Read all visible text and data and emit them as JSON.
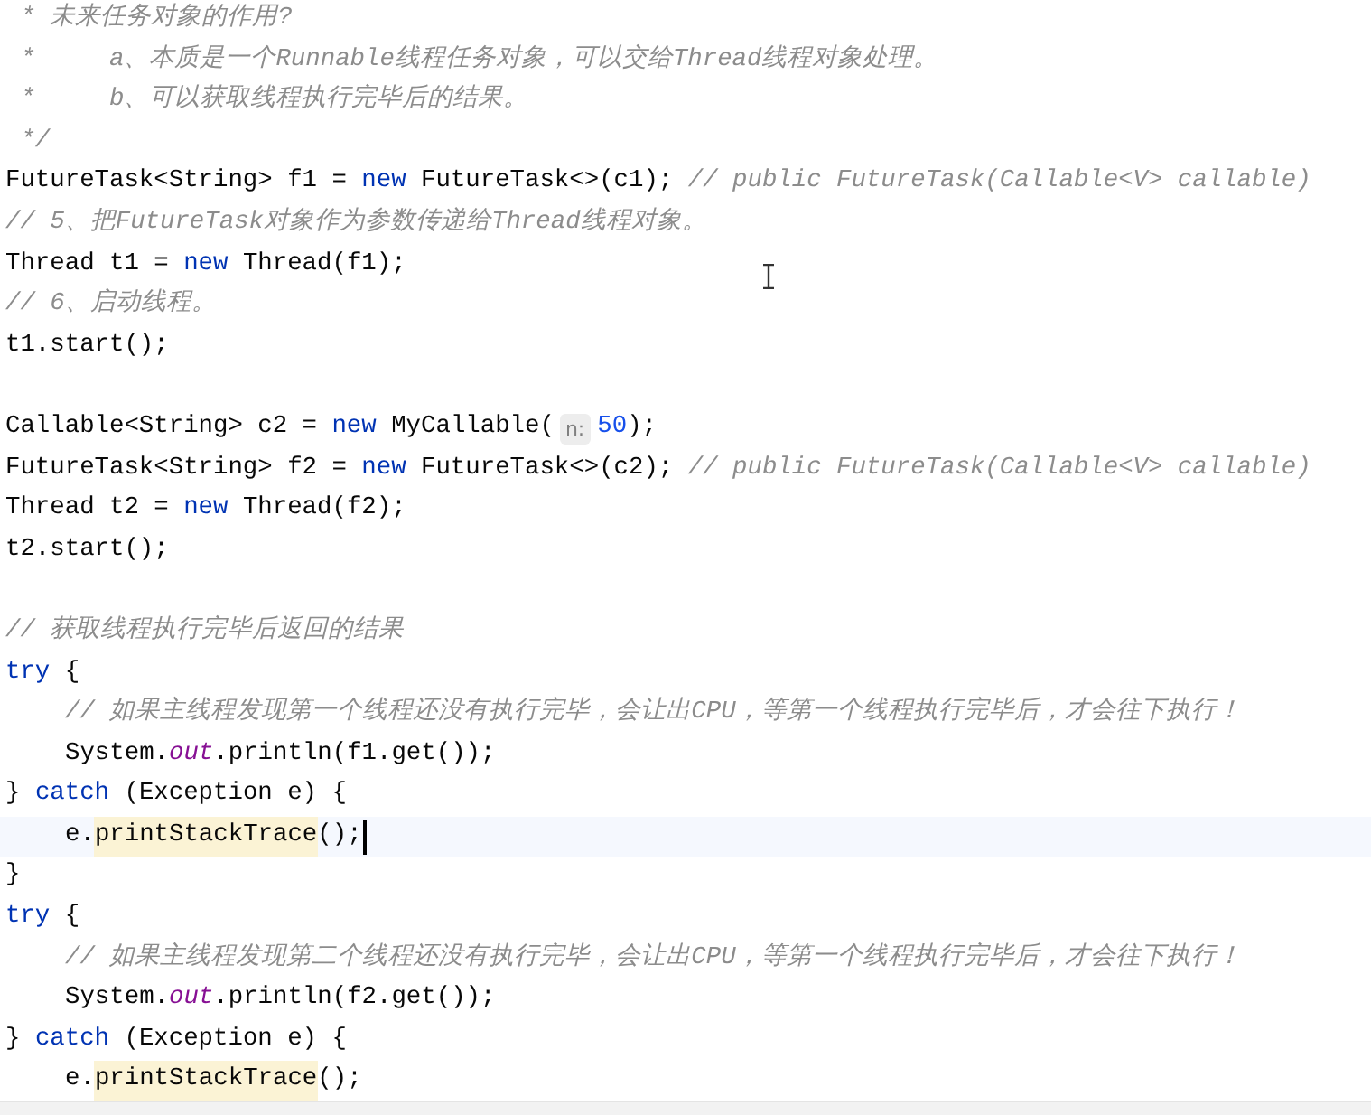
{
  "editor": {
    "lines": [
      {
        "tokens": [
          {
            "kind": "comment",
            "text": " * 未来任务对象的作用?"
          }
        ]
      },
      {
        "tokens": [
          {
            "kind": "comment",
            "text": " *     a、本质是一个Runnable线程任务对象，可以交给Thread线程对象处理。"
          }
        ]
      },
      {
        "tokens": [
          {
            "kind": "comment",
            "text": " *     b、可以获取线程执行完毕后的结果。"
          }
        ]
      },
      {
        "tokens": [
          {
            "kind": "comment",
            "text": " */"
          }
        ]
      },
      {
        "tokens": [
          {
            "kind": "text",
            "text": "FutureTask<String> f1 = "
          },
          {
            "kind": "keyword",
            "text": "new"
          },
          {
            "kind": "text",
            "text": " FutureTask<>(c1);"
          },
          {
            "kind": "comment",
            "text": " // public FutureTask(Callable<V> callable)"
          }
        ]
      },
      {
        "tokens": [
          {
            "kind": "comment",
            "text": "// 5、把FutureTask对象作为参数传递给Thread线程对象。"
          }
        ]
      },
      {
        "tokens": [
          {
            "kind": "text",
            "text": "Thread t1 = "
          },
          {
            "kind": "keyword",
            "text": "new"
          },
          {
            "kind": "text",
            "text": " Thread(f1);"
          }
        ]
      },
      {
        "tokens": [
          {
            "kind": "comment",
            "text": "// 6、启动线程。"
          }
        ]
      },
      {
        "tokens": [
          {
            "kind": "text",
            "text": "t1.start();"
          }
        ]
      },
      {
        "blank_before": true,
        "tokens": [
          {
            "kind": "text",
            "text": "Callable<String> c2 = "
          },
          {
            "kind": "keyword",
            "text": "new"
          },
          {
            "kind": "text",
            "text": " MyCallable("
          },
          {
            "kind": "hint",
            "text": "n:"
          },
          {
            "kind": "number",
            "text": "50"
          },
          {
            "kind": "text",
            "text": ");"
          }
        ]
      },
      {
        "tokens": [
          {
            "kind": "text",
            "text": "FutureTask<String> f2 = "
          },
          {
            "kind": "keyword",
            "text": "new"
          },
          {
            "kind": "text",
            "text": " FutureTask<>(c2);"
          },
          {
            "kind": "comment",
            "text": " // public FutureTask(Callable<V> callable)"
          }
        ]
      },
      {
        "tokens": [
          {
            "kind": "text",
            "text": "Thread t2 = "
          },
          {
            "kind": "keyword",
            "text": "new"
          },
          {
            "kind": "text",
            "text": " Thread(f2);"
          }
        ]
      },
      {
        "tokens": [
          {
            "kind": "text",
            "text": "t2.start();"
          }
        ]
      },
      {
        "blank_before": true,
        "tokens": [
          {
            "kind": "comment",
            "text": "// 获取线程执行完毕后返回的结果"
          }
        ]
      },
      {
        "tokens": [
          {
            "kind": "keyword",
            "text": "try"
          },
          {
            "kind": "text",
            "text": " {"
          }
        ],
        "children": [
          {
            "tokens": [
              {
                "kind": "comment",
                "text": "// 如果主线程发现第一个线程还没有执行完毕，会让出CPU，等第一个线程执行完毕后，才会往下执行！"
              }
            ]
          },
          {
            "tokens": [
              {
                "kind": "text",
                "text": "System."
              },
              {
                "kind": "field",
                "text": "out"
              },
              {
                "kind": "text",
                "text": ".println(f1.get());"
              }
            ]
          }
        ]
      },
      {
        "tokens": [
          {
            "kind": "text",
            "text": "} "
          },
          {
            "kind": "keyword",
            "text": "catch"
          },
          {
            "kind": "text",
            "text": " (Exception e) {"
          }
        ],
        "children": [
          {
            "current": true,
            "tokens": [
              {
                "kind": "text",
                "text": "e."
              },
              {
                "kind": "usage",
                "text": "printStackTrace"
              },
              {
                "kind": "text",
                "text": "();"
              }
            ]
          }
        ]
      },
      {
        "tokens": [
          {
            "kind": "text",
            "text": "}"
          }
        ]
      },
      {
        "tokens": [
          {
            "kind": "keyword",
            "text": "try"
          },
          {
            "kind": "text",
            "text": " {"
          }
        ],
        "children": [
          {
            "tokens": [
              {
                "kind": "comment",
                "text": "// 如果主线程发现第二个线程还没有执行完毕，会让出CPU，等第一个线程执行完毕后，才会往下执行！"
              }
            ]
          },
          {
            "tokens": [
              {
                "kind": "text",
                "text": "System."
              },
              {
                "kind": "field",
                "text": "out"
              },
              {
                "kind": "text",
                "text": ".println(f2.get());"
              }
            ]
          }
        ]
      },
      {
        "tokens": [
          {
            "kind": "text",
            "text": "} "
          },
          {
            "kind": "keyword",
            "text": "catch"
          },
          {
            "kind": "text",
            "text": " (Exception e) {"
          }
        ],
        "children": [
          {
            "tokens": [
              {
                "kind": "text",
                "text": "e."
              },
              {
                "kind": "usage",
                "text": "printStackTrace"
              },
              {
                "kind": "text",
                "text": "();"
              }
            ]
          }
        ]
      }
    ]
  }
}
